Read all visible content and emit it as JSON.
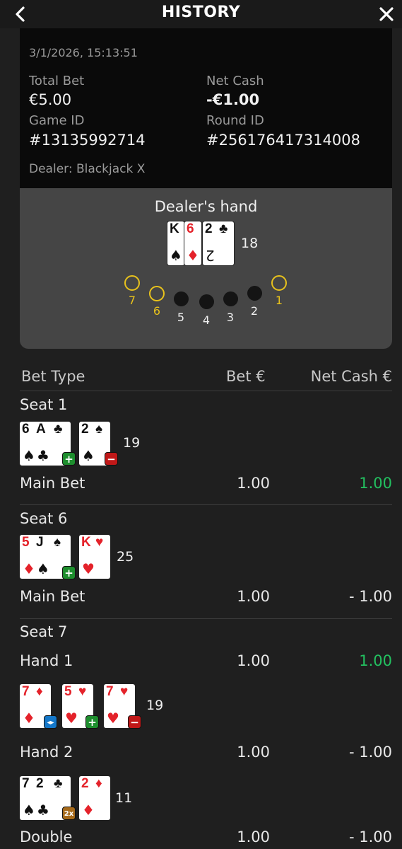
{
  "header": {
    "title": "HISTORY",
    "back_icon": "chevron-left-icon",
    "close_icon": "close-icon"
  },
  "round": {
    "datetime": "3/1/2026, 15:13:51",
    "total_bet_label": "Total Bet",
    "total_bet": "€5.00",
    "net_cash_label": "Net Cash",
    "net_cash": "-€1.00",
    "game_id_label": "Game ID",
    "game_id": "#13135992714",
    "round_id_label": "Round ID",
    "round_id": "#256176417314008",
    "dealer": "Dealer: Blackjack X"
  },
  "dealer_hand": {
    "title": "Dealer's hand",
    "cards": [
      {
        "rank": "K",
        "suit": "♠",
        "color": "#111111"
      },
      {
        "rank": "6",
        "suit": "♦",
        "color": "#e4222a"
      },
      {
        "rank": "2",
        "suit": "♣",
        "color": "#111111"
      }
    ],
    "total": "18"
  },
  "seats": [
    {
      "num": "7",
      "occupied": true
    },
    {
      "num": "6",
      "occupied": true
    },
    {
      "num": "5",
      "occupied": false
    },
    {
      "num": "4",
      "occupied": false
    },
    {
      "num": "3",
      "occupied": false
    },
    {
      "num": "2",
      "occupied": false
    },
    {
      "num": "1",
      "occupied": true
    }
  ],
  "table_header": {
    "bet_type": "Bet Type",
    "bet": "Bet €",
    "net_cash": "Net Cash €"
  },
  "seat1": {
    "label": "Seat 1",
    "total": "19",
    "cards": [
      "6♠",
      "A♣",
      "2♠"
    ],
    "row": {
      "type": "Main Bet",
      "bet": "1.00",
      "net": "1.00"
    }
  },
  "seat6": {
    "label": "Seat 6",
    "total": "25",
    "cards": [
      "5♦",
      "J♠",
      "K♥"
    ],
    "row": {
      "type": "Main Bet",
      "bet": "1.00",
      "net": "- 1.00"
    }
  },
  "seat7": {
    "label": "Seat 7",
    "hand1": {
      "label": "Hand 1",
      "bet": "1.00",
      "net": "1.00",
      "total": "19",
      "cards": [
        "7♦",
        "5♥",
        "7♥"
      ]
    },
    "hand2": {
      "label": "Hand 2",
      "bet": "1.00",
      "net": "- 1.00",
      "total": "11",
      "cards": [
        "7♠",
        "2♣",
        "2♦"
      ]
    },
    "double": {
      "label": "Double",
      "bet": "1.00",
      "net": "- 1.00"
    }
  },
  "badges": {
    "hit": "+",
    "stand": "−",
    "split": "◂▸",
    "double": "2x"
  },
  "colors": {
    "win": "#23c060",
    "seat_active": "#e8c21c",
    "card_red": "#e4222a"
  }
}
